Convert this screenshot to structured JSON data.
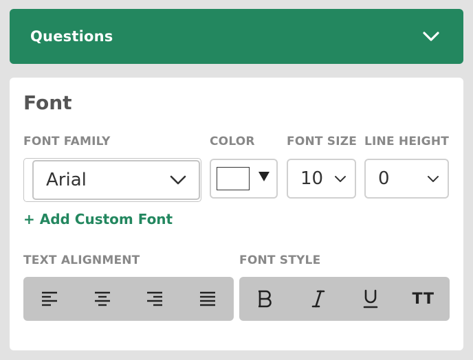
{
  "header": {
    "title": "Questions",
    "chevron_icon": "chevron-down-icon"
  },
  "font_section": {
    "title": "Font",
    "font_family": {
      "label": "FONT FAMILY",
      "value": "Arial"
    },
    "color": {
      "label": "COLOR",
      "value": "#ffffff"
    },
    "font_size": {
      "label": "FONT SIZE",
      "value": "10"
    },
    "line_height": {
      "label": "LINE HEIGHT",
      "value": "0"
    },
    "add_custom_font": "+ Add Custom Font",
    "text_alignment": {
      "label": "TEXT ALIGNMENT",
      "buttons": [
        "align-left-icon",
        "align-center-icon",
        "align-right-icon",
        "align-justify-icon"
      ]
    },
    "font_style": {
      "label": "FONT STYLE",
      "buttons": [
        "bold-icon",
        "italic-icon",
        "underline-icon",
        "uppercase-icon"
      ],
      "uppercase_glyph": "TT"
    }
  },
  "colors": {
    "accent": "#23875f",
    "background": "#e2e2e2",
    "button_group": "#c4c4c4"
  }
}
